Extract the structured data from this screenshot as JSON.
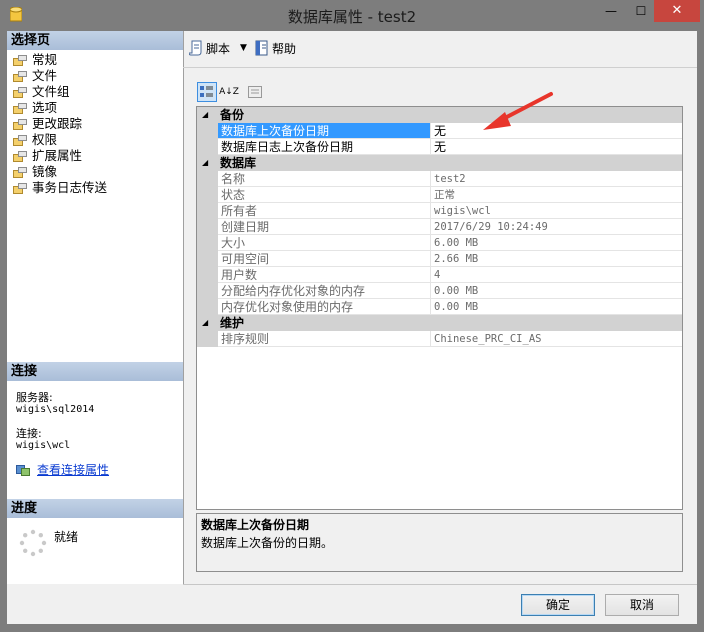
{
  "window": {
    "title": "数据库属性 - test2",
    "min_glyph": "—",
    "max_glyph": "☐",
    "close_glyph": "✕"
  },
  "select_page": {
    "header": "选择页",
    "items": [
      "常规",
      "文件",
      "文件组",
      "选项",
      "更改跟踪",
      "权限",
      "扩展属性",
      "镜像",
      "事务日志传送"
    ]
  },
  "connection": {
    "header": "连接",
    "server_label": "服务器:",
    "server_value": "wigis\\sql2014",
    "conn_label": "连接:",
    "conn_value": "wigis\\wcl",
    "link": "查看连接属性"
  },
  "progress": {
    "header": "进度",
    "status": "就绪"
  },
  "toolbar": {
    "script": "脚本",
    "help": "帮助"
  },
  "grid_toolbar": {
    "categorized": "categorized-icon",
    "alphabetical": "A↓Z",
    "pages": "property-pages-icon"
  },
  "properties": {
    "categories": [
      {
        "name": "备份",
        "rows": [
          {
            "name": "数据库上次备份日期",
            "value": "无",
            "selected": true,
            "editable": true
          },
          {
            "name": "数据库日志上次备份日期",
            "value": "无",
            "editable": true
          }
        ]
      },
      {
        "name": "数据库",
        "rows": [
          {
            "name": "名称",
            "value": "test2"
          },
          {
            "name": "状态",
            "value": "正常"
          },
          {
            "name": "所有者",
            "value": "wigis\\wcl"
          },
          {
            "name": "创建日期",
            "value": "2017/6/29 10:24:49"
          },
          {
            "name": "大小",
            "value": "6.00 MB"
          },
          {
            "name": "可用空间",
            "value": "2.66 MB"
          },
          {
            "name": "用户数",
            "value": "4"
          },
          {
            "name": "分配给内存优化对象的内存",
            "value": "0.00 MB"
          },
          {
            "name": "内存优化对象使用的内存",
            "value": "0.00 MB"
          }
        ]
      },
      {
        "name": "维护",
        "rows": [
          {
            "name": "排序规则",
            "value": "Chinese_PRC_CI_AS"
          }
        ]
      }
    ]
  },
  "description": {
    "title": "数据库上次备份日期",
    "text": "数据库上次备份的日期。"
  },
  "buttons": {
    "ok": "确定",
    "cancel": "取消"
  },
  "colors": {
    "selection": "#3399ff",
    "annotation_arrow": "#e8352b",
    "section_header": "#b6c8df"
  }
}
